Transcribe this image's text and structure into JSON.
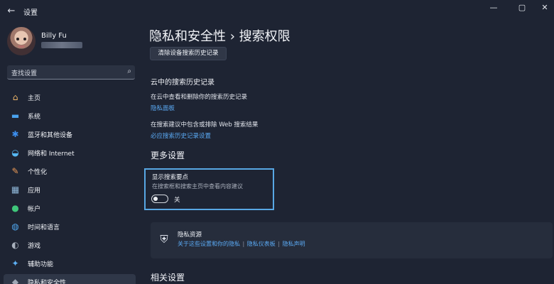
{
  "window": {
    "title": "设置",
    "back_glyph": "←",
    "controls": {
      "minimize": "—",
      "maximize": "▢",
      "close": "✕"
    }
  },
  "user": {
    "name": "Billy Fu"
  },
  "search": {
    "placeholder": "查找设置"
  },
  "sidebar": {
    "items": [
      {
        "label": "主页",
        "icon": "home-icon",
        "glyph": "⌂",
        "color": "#f0b76a"
      },
      {
        "label": "系统",
        "icon": "monitor-icon",
        "glyph": "▬",
        "color": "#4aa3ef"
      },
      {
        "label": "蓝牙和其他设备",
        "icon": "bluetooth-icon",
        "glyph": "✱",
        "color": "#3c8ff0"
      },
      {
        "label": "网络和 Internet",
        "icon": "wifi-icon",
        "glyph": "◒",
        "color": "#56b8f4"
      },
      {
        "label": "个性化",
        "icon": "brush-icon",
        "glyph": "✎",
        "color": "#f19d57"
      },
      {
        "label": "应用",
        "icon": "apps-icon",
        "glyph": "▦",
        "color": "#8fb7d8"
      },
      {
        "label": "帐户",
        "icon": "account-icon",
        "glyph": "●",
        "color": "#3fc67a"
      },
      {
        "label": "时间和语言",
        "icon": "globe-clock-icon",
        "glyph": "◍",
        "color": "#50a7f0"
      },
      {
        "label": "游戏",
        "icon": "gamepad-icon",
        "glyph": "◐",
        "color": "#a8b0bc"
      },
      {
        "label": "辅助功能",
        "icon": "accessibility-icon",
        "glyph": "✦",
        "color": "#5eb0f5"
      },
      {
        "label": "隐私和安全性",
        "icon": "shield-icon",
        "glyph": "◆",
        "color": "#9ea7b5",
        "active": true
      }
    ]
  },
  "main": {
    "title": "隐私和安全性 › 搜索权限",
    "clear_button": "清除设备搜索历史记录",
    "cloud": {
      "heading": "云中的搜索历史记录",
      "view_desc": "在云中查看和删除你的搜索历史记录",
      "view_link": "隐私面板",
      "include_desc": "在搜索建议中包含或排除 Web 搜索结果",
      "include_link": "必应搜索历史记录设置"
    },
    "more": {
      "heading": "更多设置",
      "setting": {
        "title": "显示搜索要点",
        "desc": "在搜索框和搜索主页中查看内容建议",
        "toggle_label": "关",
        "enabled": false
      }
    },
    "resources": {
      "title": "隐私资源",
      "links": [
        "关于这些设置和你的隐私",
        "隐私仪表板",
        "隐私声明"
      ],
      "separator": "|"
    },
    "related_heading": "相关设置"
  },
  "colors": {
    "background": "#1e2433",
    "accent_link": "#5aa9f3",
    "highlight_border": "#58a7e4"
  }
}
